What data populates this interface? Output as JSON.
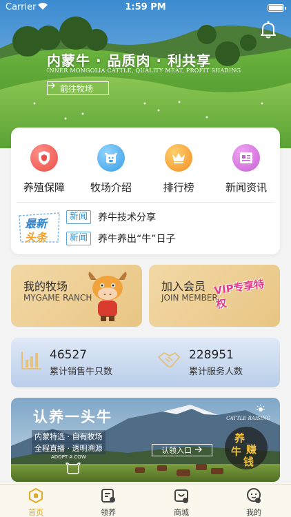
{
  "status_bar": {
    "carrier": "Carrier",
    "time": "1:59 PM"
  },
  "hero": {
    "title": "内蒙牛 · 品质肉 · 利共享",
    "subtitle": "INNER MONGOLIA CATTLE, QUALITY MEAT, PROFIT SHARING",
    "button_label": "前往牧场"
  },
  "nav": [
    {
      "label": "养殖保障",
      "icon": "shield-icon",
      "color": "#ef5b56"
    },
    {
      "label": "牧场介绍",
      "icon": "cow-icon",
      "color": "#45a8ea"
    },
    {
      "label": "排行榜",
      "icon": "crown-icon",
      "color": "#f39a2c"
    },
    {
      "label": "新闻资讯",
      "icon": "news-icon",
      "color": "#d770df"
    }
  ],
  "news": {
    "badge_line1": "最新",
    "badge_line2": "头条",
    "items": [
      {
        "tag": "新闻",
        "text": "养牛技术分享"
      },
      {
        "tag": "新闻",
        "text": "养牛养出“牛”日子"
      }
    ]
  },
  "promos": [
    {
      "title": "我的牧场",
      "subtitle": "MYGAME RANCH"
    },
    {
      "title": "加入会员",
      "subtitle": "JOIN MEMBER",
      "art_text": "VIP专享特权"
    }
  ],
  "stats": [
    {
      "value": "46527",
      "label": "累计销售牛只数"
    },
    {
      "value": "228951",
      "label": "累计服务人数"
    }
  ],
  "banner": {
    "title": "认养一头牛",
    "line1": "内蒙特选 · 自有牧场",
    "line2": "全程直播 · 透明溯源",
    "caption": "ADOPT A COW",
    "button_label": "认领入口",
    "brand": "CATTLE RAISING",
    "seal_chars": [
      "养",
      "牛",
      "赚",
      "钱"
    ]
  },
  "tabbar": [
    {
      "label": "首页",
      "icon": "home-icon",
      "active": true
    },
    {
      "label": "领养",
      "icon": "adopt-icon",
      "active": false
    },
    {
      "label": "商城",
      "icon": "shop-icon",
      "active": false
    },
    {
      "label": "我的",
      "icon": "profile-icon",
      "active": false
    }
  ],
  "colors": {
    "accent": "#e0ab28",
    "news_tag": "#3a8fd3"
  }
}
